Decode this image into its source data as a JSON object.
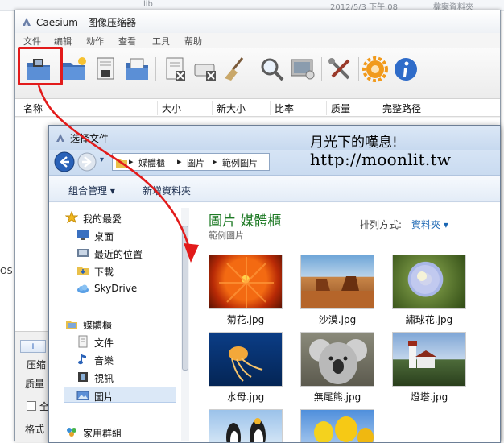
{
  "background": {
    "crumb": "lib",
    "date": "2012/5/3 下午 08",
    "type": "檔案資料夾",
    "side_label_os": "OS"
  },
  "caesium": {
    "title": "Caesium - 图像压缩器",
    "menu": [
      "文件",
      "编辑",
      "动作",
      "查看",
      "工具",
      "帮助"
    ],
    "columns": [
      "名称",
      "大小",
      "新大小",
      "比率",
      "质量",
      "完整路径"
    ],
    "left_labels": [
      "压缩",
      "质量",
      "全",
      "格式"
    ],
    "add_button": "+"
  },
  "dialog": {
    "title": "选择文件",
    "breadcrumb": [
      "媒體櫃",
      "圖片",
      "範例圖片"
    ],
    "commands": [
      "組合管理 ▾",
      "新增資料夾"
    ],
    "sidebar": {
      "favorites": "我的最愛",
      "favorites_items": [
        "桌面",
        "最近的位置",
        "下載",
        "SkyDrive"
      ],
      "libraries": "媒體櫃",
      "libraries_items": [
        "文件",
        "音樂",
        "視訊",
        "圖片"
      ],
      "homegroup": "家用群組"
    },
    "library_title": "圖片 媒體櫃",
    "library_subtitle": "範例圖片",
    "arrange_label": "排列方式:",
    "arrange_value": "資料夾 ▾",
    "files": [
      "菊花.jpg",
      "沙漠.jpg",
      "繡球花.jpg",
      "水母.jpg",
      "無尾熊.jpg",
      "燈塔.jpg"
    ]
  },
  "watermark": {
    "line1": "月光下的嘆息!",
    "line2": "http://moonlit.tw"
  },
  "colors": {
    "highlight": "#e21b1b",
    "library_title": "#1e7a25",
    "link": "#1a66b3"
  }
}
